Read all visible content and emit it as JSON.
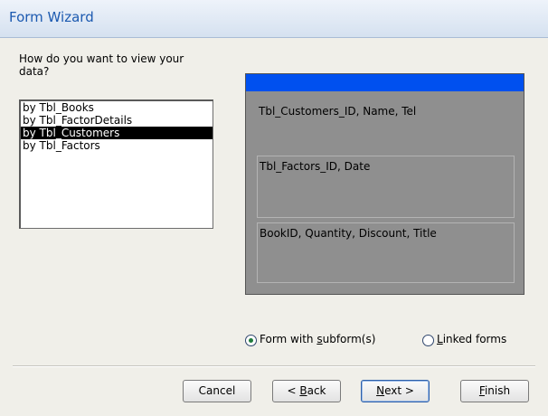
{
  "window": {
    "title": "Form Wizard"
  },
  "question": {
    "line1": "How do you want to view your",
    "line2": "data?"
  },
  "view_options": [
    {
      "label": "by Tbl_Books"
    },
    {
      "label": "by Tbl_FactorDetails"
    },
    {
      "label": "by Tbl_Customers",
      "selected": true
    },
    {
      "label": "by Tbl_Factors"
    }
  ],
  "preview": {
    "main_fields": "Tbl_Customers_ID, Name, Tel",
    "subform1_fields": "Tbl_Factors_ID, Date",
    "subform2_fields": "BookID, Quantity, Discount, Title"
  },
  "options": {
    "form_with_subforms": {
      "pre": "Form with ",
      "ul": "s",
      "post": "ubform(s)",
      "selected": true
    },
    "linked_forms": {
      "pre": "",
      "ul": "L",
      "post": "inked forms",
      "selected": false
    }
  },
  "buttons": {
    "cancel": {
      "pre": "Cancel",
      "ul": "",
      "post": ""
    },
    "back": {
      "pre": "< ",
      "ul": "B",
      "post": "ack"
    },
    "next": {
      "pre": "",
      "ul": "N",
      "post": "ext >"
    },
    "finish": {
      "pre": "",
      "ul": "F",
      "post": "inish"
    }
  },
  "colors": {
    "preview_header": "#0050ef",
    "selection": "#000000"
  }
}
